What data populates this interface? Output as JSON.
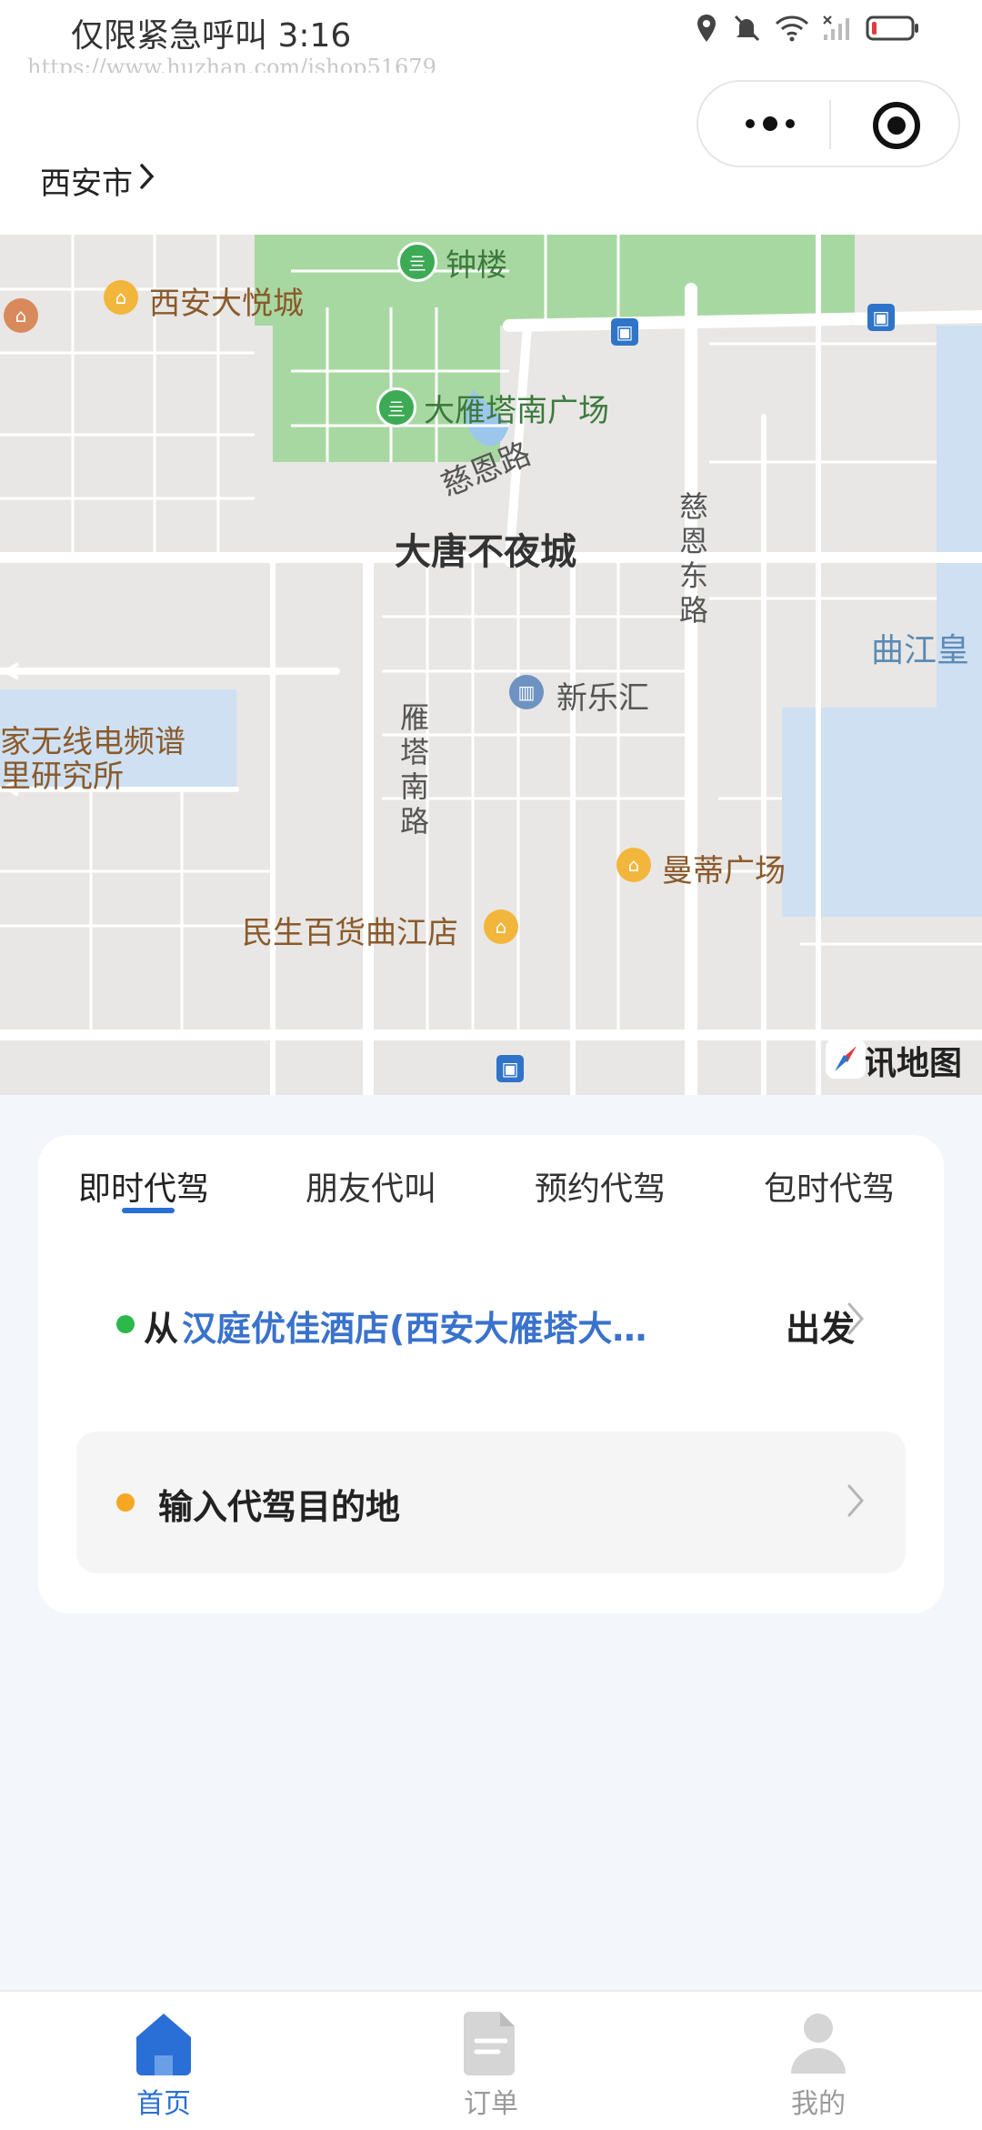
{
  "status_bar": {
    "carrier_time": "仅限紧急呼叫 3:16",
    "watermark": "https://www.huzhan.com/ishop51679",
    "icons": [
      "location-icon",
      "mute-icon",
      "wifi-icon",
      "signal-icon",
      "battery-icon"
    ]
  },
  "header": {
    "city": "西安市",
    "capsule": {
      "more_icon": "more-icon",
      "close_icon": "target-icon"
    }
  },
  "map": {
    "labels": {
      "zhonglou": "钟楼",
      "dayuecheng": "西安大悦城",
      "dayanta_square": "大雁塔南广场",
      "cien_road": "慈恩路",
      "datang": "大唐不夜城",
      "cien_east_1": "慈",
      "cien_east_2": "恩",
      "cien_east_3": "东",
      "cien_east_4": "路",
      "qujiang": "曲江皇",
      "xinlehui": "新乐汇",
      "radio_1": "家无线电频谱",
      "radio_2": "里研究所",
      "yanta_1": "雁",
      "yanta_2": "塔",
      "yanta_3": "南",
      "yanta_4": "路",
      "mandi": "曼蒂广场",
      "minsheng": "民生百货曲江店"
    },
    "logo": "腾讯地图"
  },
  "card": {
    "tabs": [
      {
        "label": "即时代驾",
        "active": true
      },
      {
        "label": "朋友代叫",
        "active": false
      },
      {
        "label": "预约代驾",
        "active": false
      },
      {
        "label": "包时代驾",
        "active": false
      }
    ],
    "from_prefix": "从",
    "from_place": "汉庭优佳酒店(西安大雁塔大…",
    "depart": "出发",
    "destination_placeholder": "输入代驾目的地"
  },
  "bottom_nav": [
    {
      "label": "首页",
      "icon": "home-icon",
      "active": true
    },
    {
      "label": "订单",
      "icon": "order-icon",
      "active": false
    },
    {
      "label": "我的",
      "icon": "profile-icon",
      "active": false
    }
  ],
  "colors": {
    "accent": "#2a6fd6",
    "start_dot": "#2cb84b",
    "end_dot": "#f5a623",
    "place_text": "#3a72cc"
  }
}
